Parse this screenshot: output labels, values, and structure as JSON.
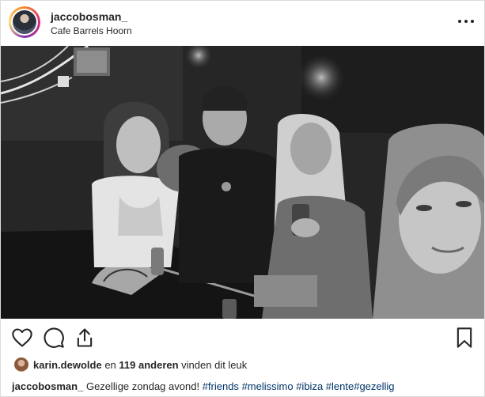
{
  "header": {
    "username": "jaccobosman_",
    "location": "Cafe Barrels Hoorn"
  },
  "photo": {
    "icon": "group-selfie-photo"
  },
  "actions": {
    "like_icon": "heart-icon",
    "comment_icon": "comment-icon",
    "share_icon": "share-icon",
    "save_icon": "bookmark-icon"
  },
  "likes": {
    "liker": "karin.dewolde",
    "middle": " en ",
    "count_text": "119 anderen",
    "suffix": " vinden dit leuk"
  },
  "caption": {
    "username": "jaccobosman_",
    "text": "Gezellige zondag avond!",
    "hashtags": [
      "#friends",
      "#melissimo",
      "#ibiza",
      "#lente",
      "#gezellig"
    ]
  },
  "colors": {
    "text": "#262626",
    "hashtag": "#003569",
    "border": "#dbdbdb"
  }
}
